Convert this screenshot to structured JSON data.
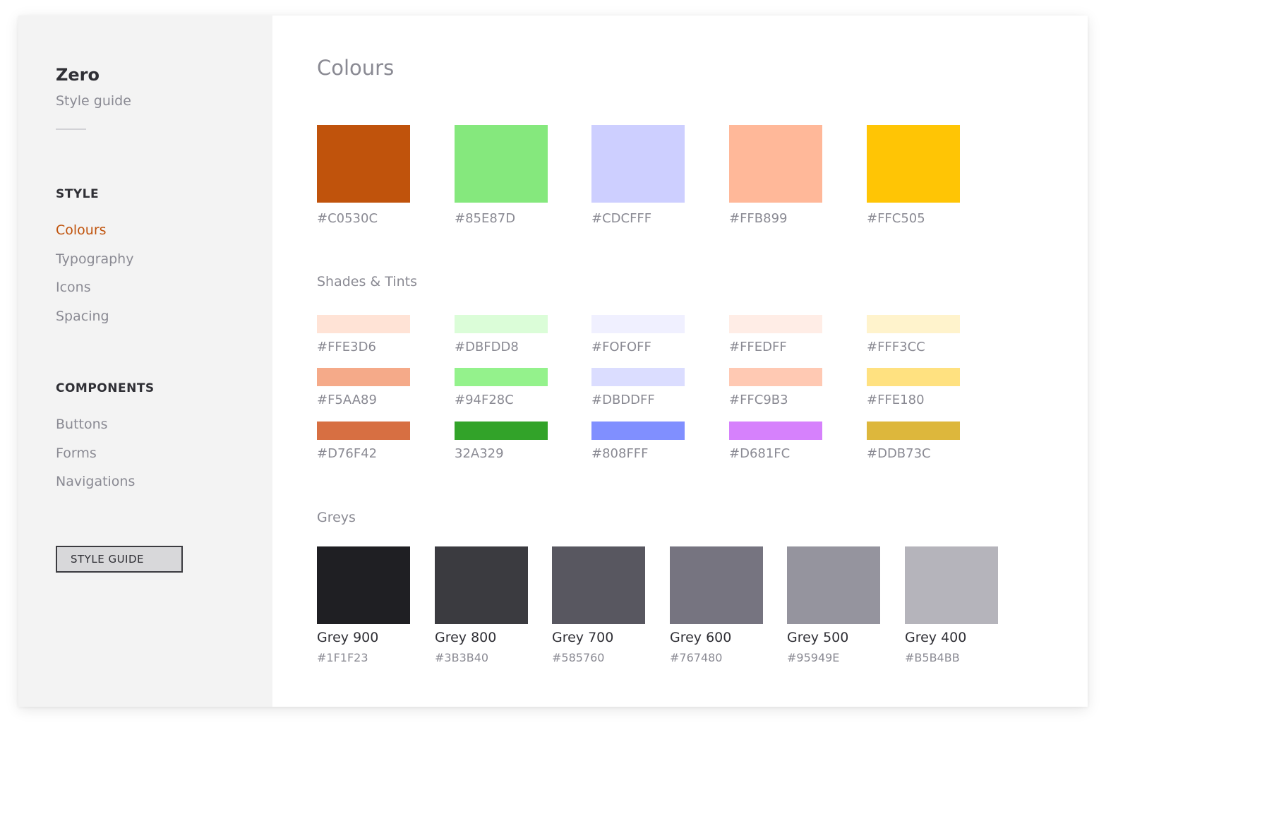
{
  "sidebar": {
    "title": "Zero",
    "subtitle": "Style guide",
    "sections": [
      {
        "heading": "STYLE",
        "items": [
          "Colours",
          "Typography",
          "Icons",
          "Spacing"
        ]
      },
      {
        "heading": "COMPONENTS",
        "items": [
          "Buttons",
          "Forms",
          "Navigations"
        ]
      }
    ],
    "active_item": "Colours",
    "button_label": "STYLE GUIDE"
  },
  "main": {
    "title": "Colours",
    "primary": [
      {
        "color": "#C0530C",
        "label": "#C0530C"
      },
      {
        "color": "#85E87D",
        "label": "#85E87D"
      },
      {
        "color": "#CDCFFF",
        "label": "#CDCFFF"
      },
      {
        "color": "#FFB899",
        "label": "#FFB899"
      },
      {
        "color": "#FFC505",
        "label": "#FFC505"
      }
    ],
    "shades_title": "Shades & Tints",
    "shades": [
      [
        {
          "color": "#FFE3D6",
          "label": "#FFE3D6"
        },
        {
          "color": "#DBFDD8",
          "label": "#DBFDD8"
        },
        {
          "color": "#F0F0FF",
          "label": "#FOFOFF"
        },
        {
          "color": "#FFEDE6",
          "label": "#FFEDFF"
        },
        {
          "color": "#FFF3CC",
          "label": "#FFF3CC"
        }
      ],
      [
        {
          "color": "#F5AA89",
          "label": "#F5AA89"
        },
        {
          "color": "#94F28C",
          "label": "#94F28C"
        },
        {
          "color": "#DBDDFF",
          "label": "#DBDDFF"
        },
        {
          "color": "#FFC9B3",
          "label": "#FFC9B3"
        },
        {
          "color": "#FFE180",
          "label": "#FFE180"
        }
      ],
      [
        {
          "color": "#D76F42",
          "label": "#D76F42"
        },
        {
          "color": "#32A329",
          "label": "32A329"
        },
        {
          "color": "#808FFF",
          "label": "#808FFF"
        },
        {
          "color": "#D681FC",
          "label": "#D681FC"
        },
        {
          "color": "#DDB73C",
          "label": "#DDB73C"
        }
      ]
    ],
    "greys_title": "Greys",
    "greys": [
      {
        "name": "Grey 900",
        "color": "#1F1F23",
        "label": "#1F1F23"
      },
      {
        "name": "Grey 800",
        "color": "#3B3B40",
        "label": "#3B3B40"
      },
      {
        "name": "Grey 700",
        "color": "#585760",
        "label": "#585760"
      },
      {
        "name": "Grey 600",
        "color": "#767480",
        "label": "#767480"
      },
      {
        "name": "Grey 500",
        "color": "#95949E",
        "label": "#95949E"
      },
      {
        "name": "Grey 400",
        "color": "#B5B4BB",
        "label": "#B5B4BB"
      }
    ]
  }
}
